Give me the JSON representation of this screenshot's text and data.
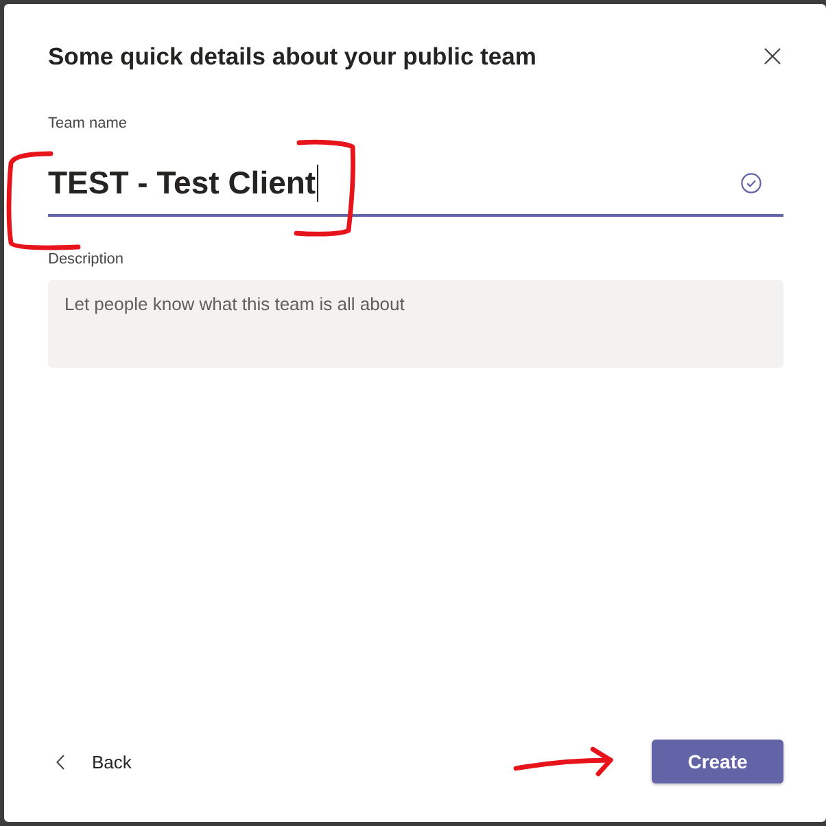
{
  "dialog": {
    "title": "Some quick details about your public team",
    "fields": [
      {
        "kind": "text",
        "label": "Team name",
        "value": "TEST - Test Client",
        "focused": true,
        "valid": true
      },
      {
        "kind": "textarea",
        "label": "Description",
        "placeholder": "Let people know what this team is all about",
        "focused": false,
        "valid": false
      }
    ],
    "buttons": [
      {
        "kind": "back",
        "label": "Back"
      },
      {
        "kind": "primary",
        "label": "Create"
      }
    ]
  },
  "annotations": [
    {
      "kind": "bracket-left"
    },
    {
      "kind": "bracket-right"
    },
    {
      "kind": "arrow"
    }
  ]
}
